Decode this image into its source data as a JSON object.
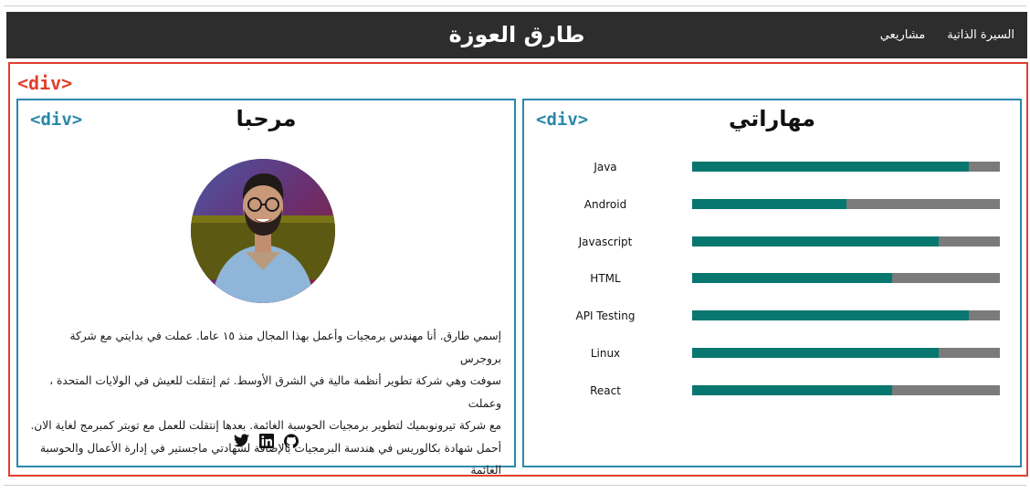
{
  "navbar": {
    "title": "طارق العوزة",
    "links": [
      "السيرة الذاتية",
      "مشاريعي"
    ]
  },
  "outer": {
    "tag": "<div>"
  },
  "left_card": {
    "tag": "<div>",
    "title": "مرحبا",
    "avatar_icon": "profile-photo",
    "bio_lines": [
      "إسمي طارق. أنا مهندس برمجيات وأعمل بهذا المجال منذ ١٥ عاما. عملت في بدايتي مع شركة بروجرس",
      "سوفت وهي شركة تطوير أنظمة مالية في الشرق الأوسط. ثم إنتقلت للعيش في الولايات المتحدة ، وعملت",
      "مع شركة تيرونوبميك لتطوير برمجيات الحوسبة الغائمة. بعدها إنتقلت للعمل مع تويتر كمبرمج لغاية الان.",
      "أحمل شهادة بكالوريس في هندسة البرمجيات بالإضافة لشهادتي ماجستير في إدارة الأعمال والحوسبة الغائمة"
    ],
    "social_icons": [
      "twitter-icon",
      "linkedin-icon",
      "github-icon"
    ]
  },
  "right_card": {
    "tag": "<div>",
    "title": "مهاراتي",
    "skills": [
      {
        "name": "Java",
        "level": 0.9
      },
      {
        "name": "Android",
        "level": 0.5
      },
      {
        "name": "Javascript",
        "level": 0.8
      },
      {
        "name": "HTML",
        "level": 0.65
      },
      {
        "name": "API Testing",
        "level": 0.9
      },
      {
        "name": "Linux",
        "level": 0.8
      },
      {
        "name": "React",
        "level": 0.65
      }
    ]
  },
  "colors": {
    "navbar_bg": "#2d2d2d",
    "outer_border": "#e0402c",
    "card_border": "#2a88aa",
    "skill_fill": "#08776f",
    "skill_track": "#7b7b7b"
  }
}
